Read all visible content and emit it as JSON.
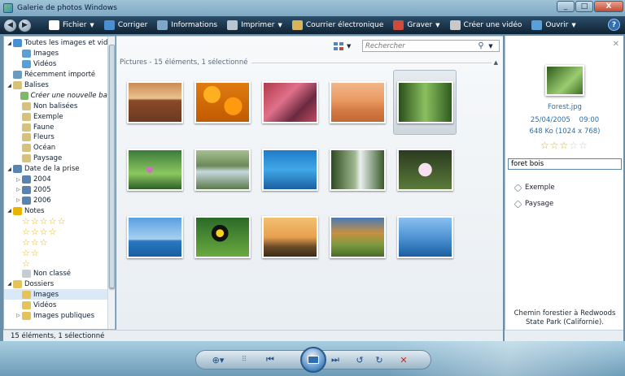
{
  "window": {
    "title": "Galerie de photos Windows",
    "buttons": [
      "_",
      "□",
      "X"
    ]
  },
  "toolbar": {
    "items": [
      {
        "label": "Fichier",
        "icon": "file-icon",
        "color": "#ffffff",
        "arrow": true
      },
      {
        "label": "Corriger",
        "icon": "fix-icon",
        "color": "#4a8fd0",
        "arrow": false
      },
      {
        "label": "Informations",
        "icon": "info-icon",
        "color": "#7fa7c8",
        "arrow": false
      },
      {
        "label": "Imprimer",
        "icon": "print-icon",
        "color": "#b9c6d1",
        "arrow": true
      },
      {
        "label": "Courrier électronique",
        "icon": "email-icon",
        "color": "#d9b45a",
        "arrow": false
      },
      {
        "label": "Graver",
        "icon": "burn-icon",
        "color": "#d04a3a",
        "arrow": true
      },
      {
        "label": "Créer une vidéo",
        "icon": "movie-icon",
        "color": "#c9c9c9",
        "arrow": false
      },
      {
        "label": "Ouvrir",
        "icon": "open-icon",
        "color": "#5aa0d8",
        "arrow": true
      }
    ],
    "help": "?"
  },
  "tree": [
    {
      "label": "Toutes les images et vidé",
      "icon_color": "#4a8fd0",
      "exp": "◢",
      "indent": 0,
      "name": "tree-all-images"
    },
    {
      "label": "Images",
      "icon_color": "#5aa0d8",
      "exp": "",
      "indent": 1,
      "name": "tree-images"
    },
    {
      "label": "Vidéos",
      "icon_color": "#5aa0d8",
      "exp": "",
      "indent": 1,
      "name": "tree-videos"
    },
    {
      "label": "Récemment importé",
      "icon_color": "#6a9ac0",
      "exp": "",
      "indent": 0,
      "name": "tree-recent"
    },
    {
      "label": "Balises",
      "icon_color": "#d6c27a",
      "exp": "◢",
      "indent": 0,
      "name": "tree-tags"
    },
    {
      "label": "Créer une nouvelle balis",
      "icon_color": "#7fb86a",
      "exp": "",
      "indent": 1,
      "italic": true,
      "name": "tree-new-tag"
    },
    {
      "label": "Non balisées",
      "icon_color": "#d6c27a",
      "exp": "",
      "indent": 1,
      "name": "tree-untagged"
    },
    {
      "label": "Exemple",
      "icon_color": "#d6c27a",
      "exp": "",
      "indent": 1,
      "name": "tree-tag-exemple"
    },
    {
      "label": "Faune",
      "icon_color": "#d6c27a",
      "exp": "",
      "indent": 1,
      "name": "tree-tag-faune"
    },
    {
      "label": "Fleurs",
      "icon_color": "#d6c27a",
      "exp": "",
      "indent": 1,
      "name": "tree-tag-fleurs"
    },
    {
      "label": "Océan",
      "icon_color": "#d6c27a",
      "exp": "",
      "indent": 1,
      "name": "tree-tag-ocean"
    },
    {
      "label": "Paysage",
      "icon_color": "#d6c27a",
      "exp": "",
      "indent": 1,
      "name": "tree-tag-paysage"
    },
    {
      "label": "Date de la prise",
      "icon_color": "#5a84b0",
      "exp": "◢",
      "indent": 0,
      "name": "tree-date"
    },
    {
      "label": "2004",
      "icon_color": "#5a84b0",
      "exp": "▷",
      "indent": 1,
      "name": "tree-2004"
    },
    {
      "label": "2005",
      "icon_color": "#5a84b0",
      "exp": "▷",
      "indent": 1,
      "name": "tree-2005"
    },
    {
      "label": "2006",
      "icon_color": "#5a84b0",
      "exp": "▷",
      "indent": 1,
      "name": "tree-2006"
    },
    {
      "label": "Notes",
      "icon_color": "#e8b400",
      "exp": "◢",
      "indent": 0,
      "name": "tree-ratings"
    },
    {
      "stars": 5,
      "indent": 1,
      "name": "tree-rating-5"
    },
    {
      "stars": 4,
      "indent": 1,
      "name": "tree-rating-4"
    },
    {
      "stars": 3,
      "indent": 1,
      "name": "tree-rating-3"
    },
    {
      "stars": 2,
      "indent": 1,
      "name": "tree-rating-2"
    },
    {
      "stars": 1,
      "indent": 1,
      "name": "tree-rating-1"
    },
    {
      "label": "Non classé",
      "icon_color": "#c5ccd2",
      "exp": "",
      "indent": 1,
      "name": "tree-unrated"
    },
    {
      "label": "Dossiers",
      "icon_color": "#e3c35a",
      "exp": "◢",
      "indent": 0,
      "name": "tree-folders"
    },
    {
      "label": "Images",
      "icon_color": "#e3c35a",
      "exp": "",
      "indent": 1,
      "selected": true,
      "name": "tree-folder-images"
    },
    {
      "label": "Vidéos",
      "icon_color": "#e3c35a",
      "exp": "",
      "indent": 1,
      "name": "tree-folder-videos"
    },
    {
      "label": "Images publiques",
      "icon_color": "#e3c35a",
      "exp": "▷",
      "indent": 1,
      "name": "tree-public-images"
    }
  ],
  "search": {
    "placeholder": "Rechercher"
  },
  "group_header": "Pictures - 15 éléments, 1 sélectionné",
  "thumbnails": [
    {
      "name": "thumb-desert-rocks",
      "bg": "linear-gradient(#c98a55 0%, #e9c48f 40%, #8a4a28 45%, #6b3a20 100%)"
    },
    {
      "name": "thumb-orange-flowers",
      "bg": "radial-gradient(circle at 30% 30%, #ffb020 0 18%, transparent 19%), radial-gradient(circle at 70% 60%, #ff9a10 0 20%, transparent 21%), linear-gradient(#e07b10, #c05a00)"
    },
    {
      "name": "thumb-red-leaves",
      "bg": "linear-gradient(135deg, #b03a48, #e0708a 40%, #6a2a40 70%, #c04a60)"
    },
    {
      "name": "thumb-oryx-desert",
      "bg": "linear-gradient(#f2b78a 0%, #e99a62 45%, #d47a44 70%, #c26a34 100%)"
    },
    {
      "name": "thumb-forest",
      "bg": "linear-gradient(90deg, #2a4e1a, #8ac060 50%, #2f5a20)",
      "selected": true
    },
    {
      "name": "thumb-green-plants",
      "bg": "radial-gradient(circle at 40% 50%, #d070c0 0 8%, transparent 9%), linear-gradient(#3d7a3a, #8cc860 60%, #2e5e28)"
    },
    {
      "name": "thumb-river-stream",
      "bg": "linear-gradient(#a8c090 0%, #6a8a58 40%, #c8d8e0 55%, #5a7a48 100%)"
    },
    {
      "name": "thumb-sea-turtle",
      "bg": "linear-gradient(#1f7ac8, #40a8e8 50%, #1a5ea0)"
    },
    {
      "name": "thumb-waterfall",
      "bg": "linear-gradient(90deg, #2e4a20, #a0b890 45%, #e8f0f0 55%, #3a5a28)"
    },
    {
      "name": "thumb-frangipani",
      "bg": "radial-gradient(circle at 50% 50%, #f6e0f0 0 20%, transparent 21%), linear-gradient(#2a3a20, #5a7a3a)"
    },
    {
      "name": "thumb-dock-sea",
      "bg": "linear-gradient(#5aa0e0 0%, #a8d0f0 55%, #2a78c0 60%, #1a5ea0 100%)"
    },
    {
      "name": "thumb-toucan",
      "bg": "radial-gradient(circle at 45% 40%, #f8d020 0 10%, #111 11% 22%, transparent 23%), linear-gradient(#2a6a28, #6aaa40)"
    },
    {
      "name": "thumb-autumn-tree",
      "bg": "linear-gradient(#f2c070 0%, #e8a050 50%, #6a4a28 75%, #3a2a18 100%)"
    },
    {
      "name": "thumb-autumn-field",
      "bg": "linear-gradient(#4a7ab8 0%, #c89040 40%, #7a9a40 70%, #4a6a28 100%)"
    },
    {
      "name": "thumb-whale-tail",
      "bg": "linear-gradient(#8ac0f0 0%, #4a90d0 55%, #1a5ea0 100%)"
    }
  ],
  "details": {
    "filename": "Forest.jpg",
    "date": "25/04/2005",
    "time": "09:00",
    "size": "648 Ko (1024 x 768)",
    "rating": 3,
    "rating_max": 5,
    "tag_input_value": "foret bois",
    "tags": [
      "Exemple",
      "Paysage"
    ],
    "caption_line1": "Chemin forestier à Redwoods",
    "caption_line2": "State Park (Californie)."
  },
  "status": {
    "text": "15 éléments, 1 sélectionné"
  }
}
